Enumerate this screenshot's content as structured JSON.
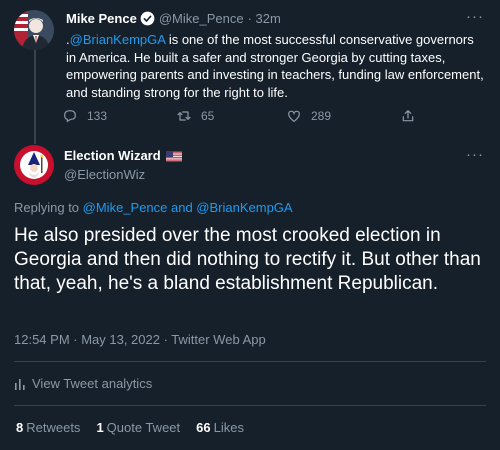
{
  "parent_tweet": {
    "author_name": "Mike Pence",
    "author_handle": "@Mike_Pence",
    "time": "· 32m",
    "text_prefix": ".",
    "mention": "@BrianKempGA",
    "text": " is one of the most successful conservative governors in America. He built a safer and stronger Georgia by cutting taxes, empowering parents and investing in teachers, funding law enforcement, and standing strong for the right to life.",
    "replies": "133",
    "retweets": "65",
    "likes": "289"
  },
  "main_tweet": {
    "author_name": "Election Wizard",
    "author_handle": "@ElectionWiz",
    "replying_prefix": "Replying to ",
    "replying_to": "@Mike_Pence and @BrianKempGA",
    "text": "He also presided over the most crooked election in Georgia and then did nothing to rectify it. But other than that, yeah, he's a bland establishment Republican.",
    "meta": "12:54 PM · May 13, 2022 · Twitter Web App",
    "analytics_label": "View Tweet analytics",
    "retweet_count": "8",
    "retweet_label": "Retweets",
    "quote_count": "1",
    "quote_label": "Quote Tweet",
    "like_count": "66",
    "like_label": "Likes"
  },
  "more_glyph": "···",
  "colors": {
    "background": "#15202b",
    "accent": "#1d9bf0",
    "muted": "#8b98a5",
    "divider": "#38444d"
  },
  "icons": [
    "verified-badge-icon",
    "reply-icon",
    "retweet-icon",
    "like-icon",
    "share-icon",
    "us-flag-icon",
    "analytics-icon"
  ]
}
